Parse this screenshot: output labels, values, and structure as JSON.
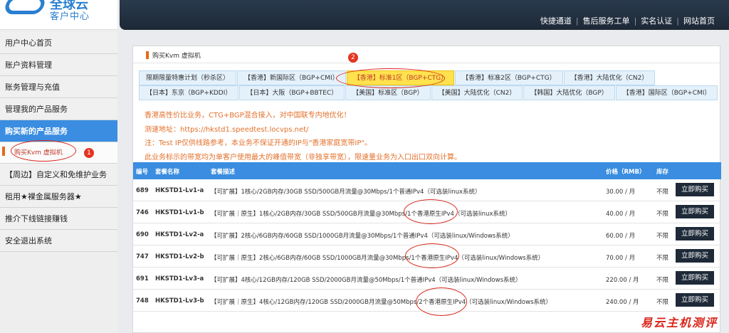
{
  "logo": {
    "title": "全球云",
    "subtitle": "客户中心"
  },
  "sidebar": {
    "items": [
      {
        "label": "用户中心首页"
      },
      {
        "label": "账户资料管理"
      },
      {
        "label": "账务管理与充值"
      },
      {
        "label": "管理我的产品服务"
      },
      {
        "label": "购买新的产品服务"
      },
      {
        "label": "【周边】自定义和免维护业务"
      },
      {
        "label": "租用★裸金属服务器★"
      },
      {
        "label": "推介下线链接赚钱"
      },
      {
        "label": "安全退出系统"
      }
    ],
    "submenu_label": "购买Kvm 虚拟机",
    "marker": "1"
  },
  "topnav": [
    {
      "label": "快捷通道"
    },
    {
      "label": "售后服务工单"
    },
    {
      "label": "实名认证"
    },
    {
      "label": "网站首页"
    }
  ],
  "panel": {
    "title": "购买Kvm 虚拟机",
    "tab_marker": "2",
    "tab_rows": [
      [
        {
          "label": "限期限量特惠计划（秒杀区）"
        },
        {
          "label": "【香港】新国际区（BGP+CMI）"
        },
        {
          "label": "【香港】标准1区（BGP+CTG）",
          "active": true
        },
        {
          "label": "【香港】标准2区（BGP+CTG）"
        },
        {
          "label": "【香港】大陆优化（CN2）"
        }
      ],
      [
        {
          "label": "【日本】东京（BGP+KDDI）"
        },
        {
          "label": "【日本】大阪（BGP+BBTEC）"
        },
        {
          "label": "【美国】标准区（BGP）"
        },
        {
          "label": "【美国】大陆优化（CN2）"
        },
        {
          "label": "【韩国】大陆优化（BGP）"
        },
        {
          "label": "【香港】国际区（BGP+CMI）"
        }
      ]
    ],
    "notes": [
      "香港高性价比业务，CTG+BGP混合接入，对中国联专内地优化！",
      "测速地址：https://hkstd1.speedtest.locvps.net/",
      "注：Test IP仅供线路参考，本业务不保证开通的IP与\"香港家庭宽带IP\"。",
      "此业务标示的带宽均为单客户使用最大的峰值带宽（非独享带宽），限速量业务为入口出口双向计算。"
    ],
    "table": {
      "headers": {
        "id": "编号",
        "name": "套餐名称",
        "desc": "套餐描述",
        "price": "价格（RMB）",
        "stock": "库存"
      },
      "buy_label": "立即购买",
      "rows": [
        {
          "id": "689",
          "name": "HKSTD1-Lv1-a",
          "desc": "【可扩展】1核心/2GB内存/30GB SSD/500GB月流量@30Mbps/1个普通IPv4（可选装linux系统）",
          "price": "30.00 / 月",
          "stock": "不限"
        },
        {
          "id": "746",
          "name": "HKSTD1-Lv1-b",
          "desc": "【可扩展｜原生】1核心/2GB内存/30GB SSD/500GB月流量@30Mbps/1个香港原生IPv4（可选装linux系统）",
          "price": "40.00 / 月",
          "stock": "不限"
        },
        {
          "id": "690",
          "name": "HKSTD1-Lv2-a",
          "desc": "【可扩展】2核心/6GB内存/60GB SSD/1000GB月流量@30Mbps/1个普通IPv4（可选装linux/Windows系统）",
          "price": "60.00 / 月",
          "stock": "不限"
        },
        {
          "id": "747",
          "name": "HKSTD1-Lv2-b",
          "desc": "【可扩展｜原生】2核心/6GB内存/60GB SSD/1000GB月流量@30Mbps/1个香港原生IPv4（可选装linux/Windows系统）",
          "price": "70.00 / 月",
          "stock": "不限"
        },
        {
          "id": "691",
          "name": "HKSTD1-Lv3-a",
          "desc": "【可扩展】4核心/12GB内存/120GB SSD/2000GB月流量@50Mbps/1个普通IPv4（可选装linux/Windows系统）",
          "price": "220.00 / 月",
          "stock": "不限"
        },
        {
          "id": "748",
          "name": "HKSTD1-Lv3-b",
          "desc": "【可扩展｜原生】4核心/12GB内存/120GB SSD/2000GB月流量@50Mbps/2个香港原生IPv4（可选装linux/Windows系统）",
          "price": "240.00 / 月",
          "stock": "不限"
        }
      ]
    }
  },
  "watermark": "易云主机测评",
  "colors": {
    "accent": "#3a8de0",
    "topbar": "#1c2836",
    "annotation": "#d9261c",
    "note_text": "#e2702a"
  }
}
